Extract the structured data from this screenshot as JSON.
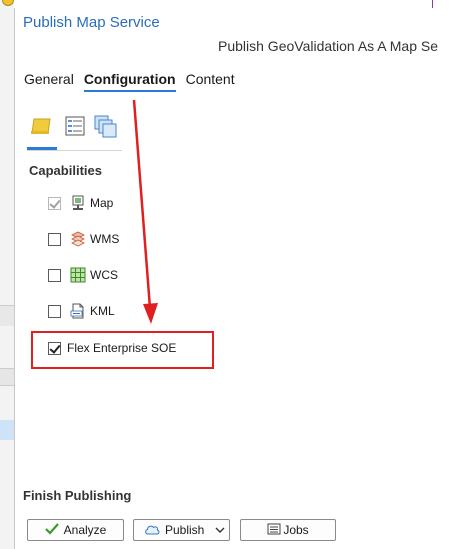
{
  "window": {
    "title": "Publish Map Service",
    "subtitle": "Publish GeoValidation As A Map Se"
  },
  "tabs": [
    {
      "label": "General",
      "active": false
    },
    {
      "label": "Configuration",
      "active": true
    },
    {
      "label": "Content",
      "active": false
    }
  ],
  "subtabs": [
    {
      "icon": "folder-icon",
      "active": true
    },
    {
      "icon": "properties-icon",
      "active": false
    },
    {
      "icon": "layers-icon",
      "active": false
    }
  ],
  "capabilities": {
    "heading": "Capabilities",
    "items": [
      {
        "label": "Map",
        "checked": true,
        "disabled": true,
        "icon": "map-service-icon"
      },
      {
        "label": "WMS",
        "checked": false,
        "disabled": false,
        "icon": "wms-icon"
      },
      {
        "label": "WCS",
        "checked": false,
        "disabled": false,
        "icon": "wcs-icon"
      },
      {
        "label": "KML",
        "checked": false,
        "disabled": false,
        "icon": "kml-icon"
      },
      {
        "label": "Flex Enterprise SOE",
        "checked": true,
        "disabled": false,
        "icon": ""
      }
    ]
  },
  "finish": {
    "heading": "Finish Publishing",
    "analyze_label": "Analyze",
    "publish_label": "Publish",
    "jobs_label": "Jobs"
  },
  "colors": {
    "accent": "#2a7ad8",
    "title": "#2a6ebb",
    "annotation": "#e02020"
  }
}
